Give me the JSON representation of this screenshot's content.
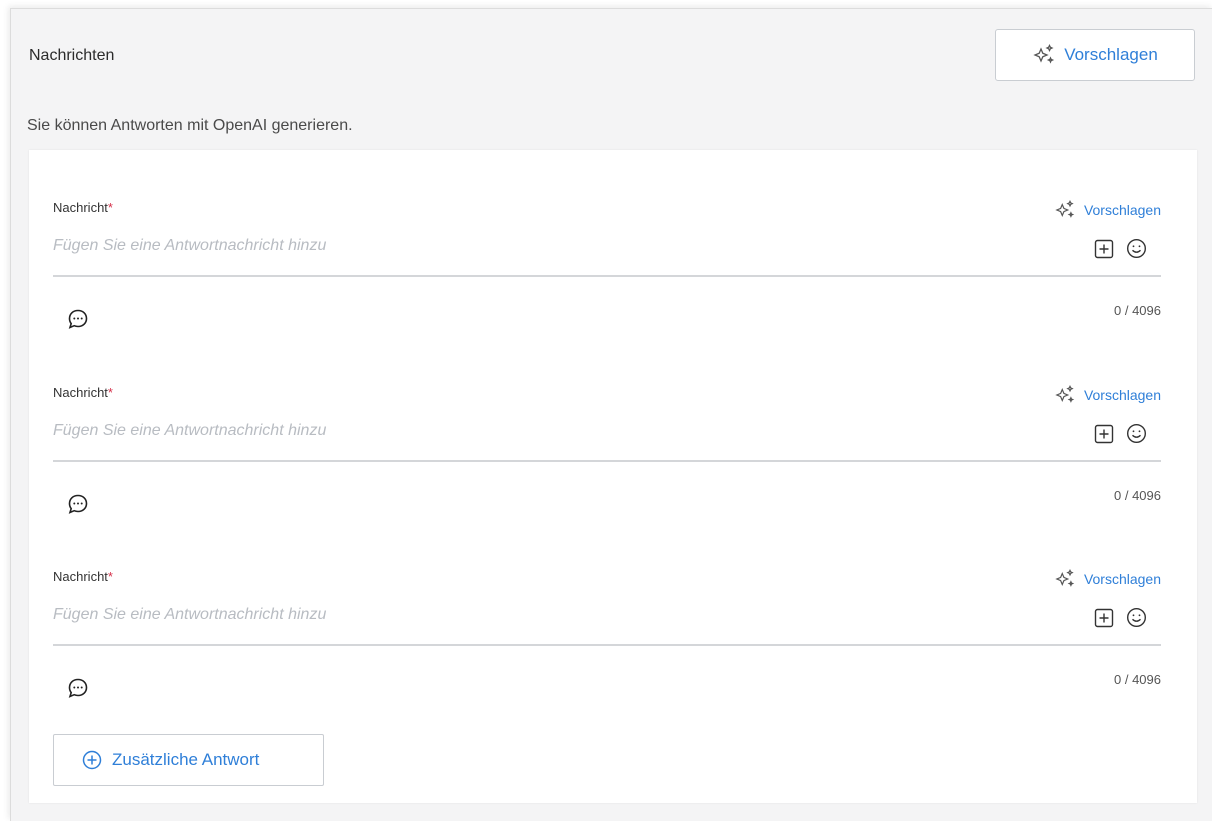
{
  "section": {
    "title": "Nachrichten",
    "suggest_label": "Vorschlagen",
    "subtitle": "Sie können Antworten mit OpenAI generieren."
  },
  "messages": [
    {
      "label": "Nachricht",
      "required_mark": "*",
      "placeholder": "Fügen Sie eine Antwortnachricht hinzu",
      "suggest_label": "Vorschlagen",
      "counter": "0 / 4096"
    },
    {
      "label": "Nachricht",
      "required_mark": "*",
      "placeholder": "Fügen Sie eine Antwortnachricht hinzu",
      "suggest_label": "Vorschlagen",
      "counter": "0 / 4096"
    },
    {
      "label": "Nachricht",
      "required_mark": "*",
      "placeholder": "Fügen Sie eine Antwortnachricht hinzu",
      "suggest_label": "Vorschlagen",
      "counter": "0 / 4096"
    }
  ],
  "add_button": {
    "label": "Zusätzliche Antwort"
  },
  "colors": {
    "accent": "#2f7fd8",
    "required": "#d6304a",
    "placeholder": "#b8bcc2",
    "background": "#f4f4f5"
  },
  "icons": {
    "suggest": "sparkle-icon",
    "insert": "plus-square-icon",
    "emoji": "smiley-icon",
    "chat": "chat-bubble-icon",
    "add": "plus-circle-icon"
  }
}
